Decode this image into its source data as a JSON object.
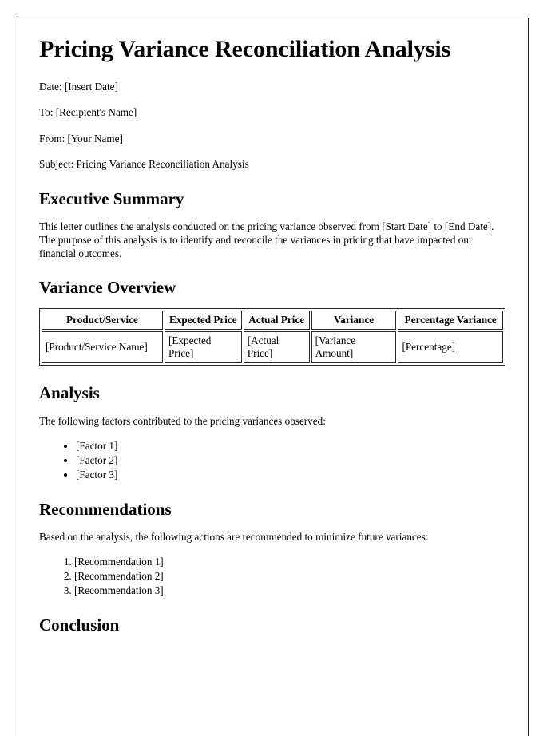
{
  "document": {
    "title": "Pricing Variance Reconciliation Analysis",
    "meta": [
      {
        "label": "Date",
        "text": "Date: [Insert Date]"
      },
      {
        "label": "To",
        "text": "To: [Recipient's Name]"
      },
      {
        "label": "From",
        "text": "From: [Your Name]"
      },
      {
        "label": "Subject",
        "text": "Subject: Pricing Variance Reconciliation Analysis"
      }
    ],
    "sections": {
      "executive_summary": {
        "heading": "Executive Summary",
        "paragraph": "This letter outlines the analysis conducted on the pricing variance observed from [Start Date] to [End Date]. The purpose of this analysis is to identify and reconcile the variances in pricing that have impacted our financial outcomes."
      },
      "variance_overview": {
        "heading": "Variance Overview",
        "table": {
          "columns": [
            "Product/Service",
            "Expected Price",
            "Actual Price",
            "Variance",
            "Percentage Variance"
          ],
          "rows": [
            [
              "[Product/Service Name]",
              "[Expected Price]",
              "[Actual Price]",
              "[Variance Amount]",
              "[Percentage]"
            ]
          ]
        }
      },
      "analysis": {
        "heading": "Analysis",
        "paragraph": "The following factors contributed to the pricing variances observed:",
        "items": [
          "[Factor 1]",
          "[Factor 2]",
          "[Factor 3]"
        ]
      },
      "recommendations": {
        "heading": "Recommendations",
        "paragraph": "Based on the analysis, the following actions are recommended to minimize future variances:",
        "items": [
          "[Recommendation 1]",
          "[Recommendation 2]",
          "[Recommendation 3]"
        ]
      },
      "conclusion": {
        "heading": "Conclusion"
      }
    }
  }
}
